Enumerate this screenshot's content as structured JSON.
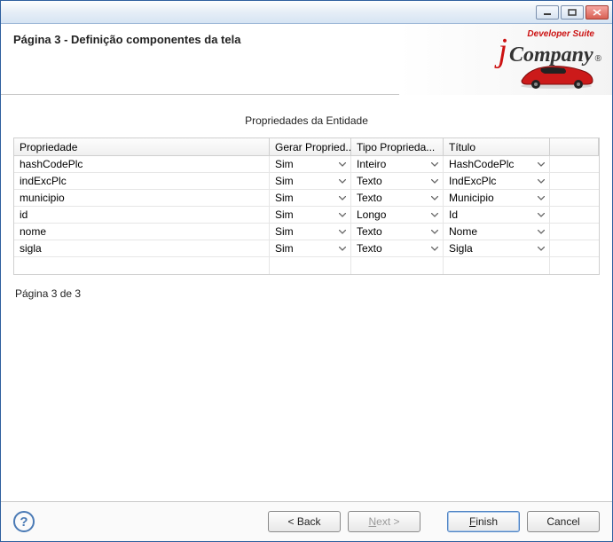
{
  "banner": {
    "title": "Página 3 - Definição componentes da tela",
    "logo_small": "Developer Suite",
    "logo_j": "j",
    "logo_company": "Company",
    "logo_reg": "®"
  },
  "table": {
    "caption": "Propriedades da Entidade",
    "headers": {
      "c0": "Propriedade",
      "c1": "Gerar Propried...",
      "c2": "Tipo Proprieda...",
      "c3": "Título",
      "c4": ""
    },
    "rows": [
      {
        "prop": "hashCodePlc",
        "gerar": "Sim",
        "tipo": "Inteiro",
        "titulo": "HashCodePlc"
      },
      {
        "prop": "indExcPlc",
        "gerar": "Sim",
        "tipo": "Texto",
        "titulo": "IndExcPlc"
      },
      {
        "prop": "municipio",
        "gerar": "Sim",
        "tipo": "Texto",
        "titulo": "Municipio"
      },
      {
        "prop": "id",
        "gerar": "Sim",
        "tipo": "Longo",
        "titulo": "Id"
      },
      {
        "prop": "nome",
        "gerar": "Sim",
        "tipo": "Texto",
        "titulo": "Nome"
      },
      {
        "prop": "sigla",
        "gerar": "Sim",
        "tipo": "Texto",
        "titulo": "Sigla"
      }
    ]
  },
  "page_indicator": "Página  3 de 3",
  "footer": {
    "back": "< Back",
    "next_prefix": "N",
    "next_rest": "ext >",
    "finish_prefix": "F",
    "finish_rest": "inish",
    "cancel": "Cancel"
  }
}
